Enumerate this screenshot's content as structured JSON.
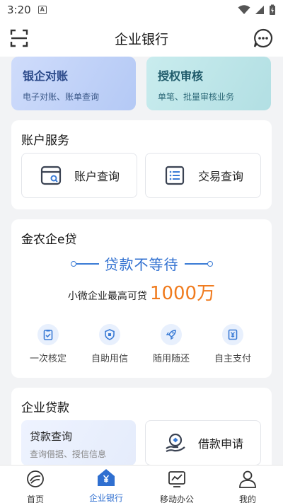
{
  "status": {
    "time": "3:20",
    "indicator": "A"
  },
  "header": {
    "title": "企业银行"
  },
  "quick_cards": [
    {
      "title": "银企对账",
      "subtitle": "电子对账、账单查询"
    },
    {
      "title": "授权审核",
      "subtitle": "单笔、批量审核业务"
    }
  ],
  "account": {
    "title": "账户服务",
    "buttons": [
      {
        "label": "账户查询",
        "icon": "account-query-icon"
      },
      {
        "label": "交易查询",
        "icon": "transaction-list-icon"
      }
    ]
  },
  "loan_promo": {
    "title": "金农企e贷",
    "slogan": "贷款不等待",
    "sub_text": "小微企业最高可贷",
    "amount": "1000万",
    "features": [
      {
        "label": "一次核定",
        "icon": "clipboard-check-icon"
      },
      {
        "label": "自助用信",
        "icon": "shield-icon"
      },
      {
        "label": "随用随还",
        "icon": "rocket-icon"
      },
      {
        "label": "自主支付",
        "icon": "yuan-doc-icon"
      }
    ]
  },
  "enterprise_loan": {
    "title": "企业贷款",
    "query": {
      "title": "贷款查询",
      "subtitle": "查询借据、授信信息"
    },
    "apply_label": "借款申请"
  },
  "tabbar": [
    {
      "label": "首页",
      "icon": "home-logo-icon",
      "active": false
    },
    {
      "label": "企业银行",
      "icon": "bank-house-icon",
      "active": true
    },
    {
      "label": "移动办公",
      "icon": "chart-monitor-icon",
      "active": false
    },
    {
      "label": "我的",
      "icon": "person-icon",
      "active": false
    }
  ],
  "colors": {
    "accent": "#2f6fd0",
    "amount": "#f07b1e",
    "background": "#f2f3f5"
  }
}
